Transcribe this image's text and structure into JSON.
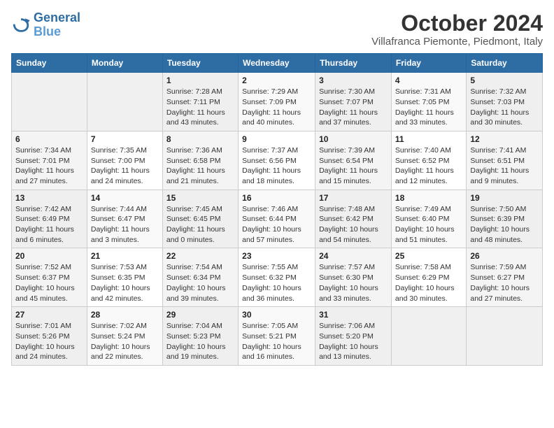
{
  "logo": {
    "line1": "General",
    "line2": "Blue"
  },
  "title": "October 2024",
  "location": "Villafranca Piemonte, Piedmont, Italy",
  "days_of_week": [
    "Sunday",
    "Monday",
    "Tuesday",
    "Wednesday",
    "Thursday",
    "Friday",
    "Saturday"
  ],
  "weeks": [
    [
      {
        "num": "",
        "info": ""
      },
      {
        "num": "",
        "info": ""
      },
      {
        "num": "1",
        "info": "Sunrise: 7:28 AM\nSunset: 7:11 PM\nDaylight: 11 hours and 43 minutes."
      },
      {
        "num": "2",
        "info": "Sunrise: 7:29 AM\nSunset: 7:09 PM\nDaylight: 11 hours and 40 minutes."
      },
      {
        "num": "3",
        "info": "Sunrise: 7:30 AM\nSunset: 7:07 PM\nDaylight: 11 hours and 37 minutes."
      },
      {
        "num": "4",
        "info": "Sunrise: 7:31 AM\nSunset: 7:05 PM\nDaylight: 11 hours and 33 minutes."
      },
      {
        "num": "5",
        "info": "Sunrise: 7:32 AM\nSunset: 7:03 PM\nDaylight: 11 hours and 30 minutes."
      }
    ],
    [
      {
        "num": "6",
        "info": "Sunrise: 7:34 AM\nSunset: 7:01 PM\nDaylight: 11 hours and 27 minutes."
      },
      {
        "num": "7",
        "info": "Sunrise: 7:35 AM\nSunset: 7:00 PM\nDaylight: 11 hours and 24 minutes."
      },
      {
        "num": "8",
        "info": "Sunrise: 7:36 AM\nSunset: 6:58 PM\nDaylight: 11 hours and 21 minutes."
      },
      {
        "num": "9",
        "info": "Sunrise: 7:37 AM\nSunset: 6:56 PM\nDaylight: 11 hours and 18 minutes."
      },
      {
        "num": "10",
        "info": "Sunrise: 7:39 AM\nSunset: 6:54 PM\nDaylight: 11 hours and 15 minutes."
      },
      {
        "num": "11",
        "info": "Sunrise: 7:40 AM\nSunset: 6:52 PM\nDaylight: 11 hours and 12 minutes."
      },
      {
        "num": "12",
        "info": "Sunrise: 7:41 AM\nSunset: 6:51 PM\nDaylight: 11 hours and 9 minutes."
      }
    ],
    [
      {
        "num": "13",
        "info": "Sunrise: 7:42 AM\nSunset: 6:49 PM\nDaylight: 11 hours and 6 minutes."
      },
      {
        "num": "14",
        "info": "Sunrise: 7:44 AM\nSunset: 6:47 PM\nDaylight: 11 hours and 3 minutes."
      },
      {
        "num": "15",
        "info": "Sunrise: 7:45 AM\nSunset: 6:45 PM\nDaylight: 11 hours and 0 minutes."
      },
      {
        "num": "16",
        "info": "Sunrise: 7:46 AM\nSunset: 6:44 PM\nDaylight: 10 hours and 57 minutes."
      },
      {
        "num": "17",
        "info": "Sunrise: 7:48 AM\nSunset: 6:42 PM\nDaylight: 10 hours and 54 minutes."
      },
      {
        "num": "18",
        "info": "Sunrise: 7:49 AM\nSunset: 6:40 PM\nDaylight: 10 hours and 51 minutes."
      },
      {
        "num": "19",
        "info": "Sunrise: 7:50 AM\nSunset: 6:39 PM\nDaylight: 10 hours and 48 minutes."
      }
    ],
    [
      {
        "num": "20",
        "info": "Sunrise: 7:52 AM\nSunset: 6:37 PM\nDaylight: 10 hours and 45 minutes."
      },
      {
        "num": "21",
        "info": "Sunrise: 7:53 AM\nSunset: 6:35 PM\nDaylight: 10 hours and 42 minutes."
      },
      {
        "num": "22",
        "info": "Sunrise: 7:54 AM\nSunset: 6:34 PM\nDaylight: 10 hours and 39 minutes."
      },
      {
        "num": "23",
        "info": "Sunrise: 7:55 AM\nSunset: 6:32 PM\nDaylight: 10 hours and 36 minutes."
      },
      {
        "num": "24",
        "info": "Sunrise: 7:57 AM\nSunset: 6:30 PM\nDaylight: 10 hours and 33 minutes."
      },
      {
        "num": "25",
        "info": "Sunrise: 7:58 AM\nSunset: 6:29 PM\nDaylight: 10 hours and 30 minutes."
      },
      {
        "num": "26",
        "info": "Sunrise: 7:59 AM\nSunset: 6:27 PM\nDaylight: 10 hours and 27 minutes."
      }
    ],
    [
      {
        "num": "27",
        "info": "Sunrise: 7:01 AM\nSunset: 5:26 PM\nDaylight: 10 hours and 24 minutes."
      },
      {
        "num": "28",
        "info": "Sunrise: 7:02 AM\nSunset: 5:24 PM\nDaylight: 10 hours and 22 minutes."
      },
      {
        "num": "29",
        "info": "Sunrise: 7:04 AM\nSunset: 5:23 PM\nDaylight: 10 hours and 19 minutes."
      },
      {
        "num": "30",
        "info": "Sunrise: 7:05 AM\nSunset: 5:21 PM\nDaylight: 10 hours and 16 minutes."
      },
      {
        "num": "31",
        "info": "Sunrise: 7:06 AM\nSunset: 5:20 PM\nDaylight: 10 hours and 13 minutes."
      },
      {
        "num": "",
        "info": ""
      },
      {
        "num": "",
        "info": ""
      }
    ]
  ]
}
